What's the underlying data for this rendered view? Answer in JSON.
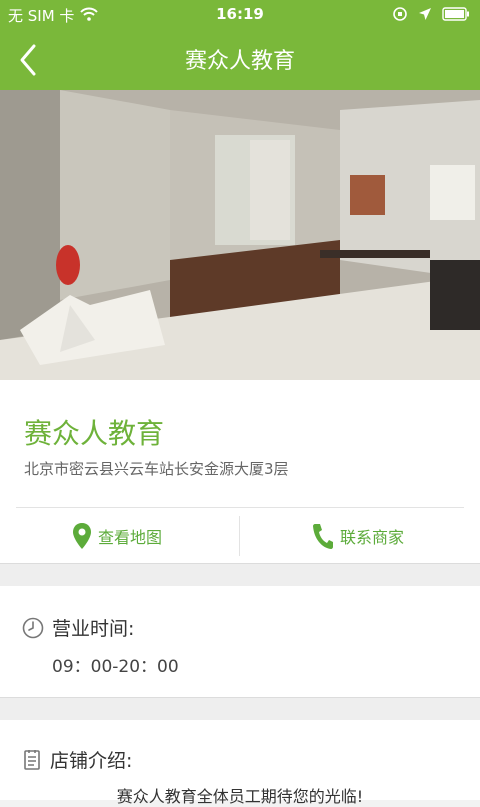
{
  "status_bar": {
    "carrier": "无 SIM 卡",
    "time": "16:19",
    "icons": [
      "wifi-icon",
      "orientation-lock-icon",
      "location-icon",
      "battery-icon"
    ]
  },
  "nav": {
    "title": "赛众人教育",
    "back_icon": "chevron-left-icon"
  },
  "shop": {
    "name": "赛众人教育",
    "address": "北京市密云县兴云车站长安金源大厦3层"
  },
  "actions": {
    "map_label": "查看地图",
    "call_label": "联系商家"
  },
  "hours": {
    "title": "营业时间:",
    "value": "09：00-20：00"
  },
  "intro": {
    "title": "店铺介绍:",
    "text": "赛众人教育全体员工期待您的光临!"
  },
  "colors": {
    "brand_green": "#7ab83a",
    "accent_green": "#5cab3a",
    "background": "#f2f2f2"
  }
}
